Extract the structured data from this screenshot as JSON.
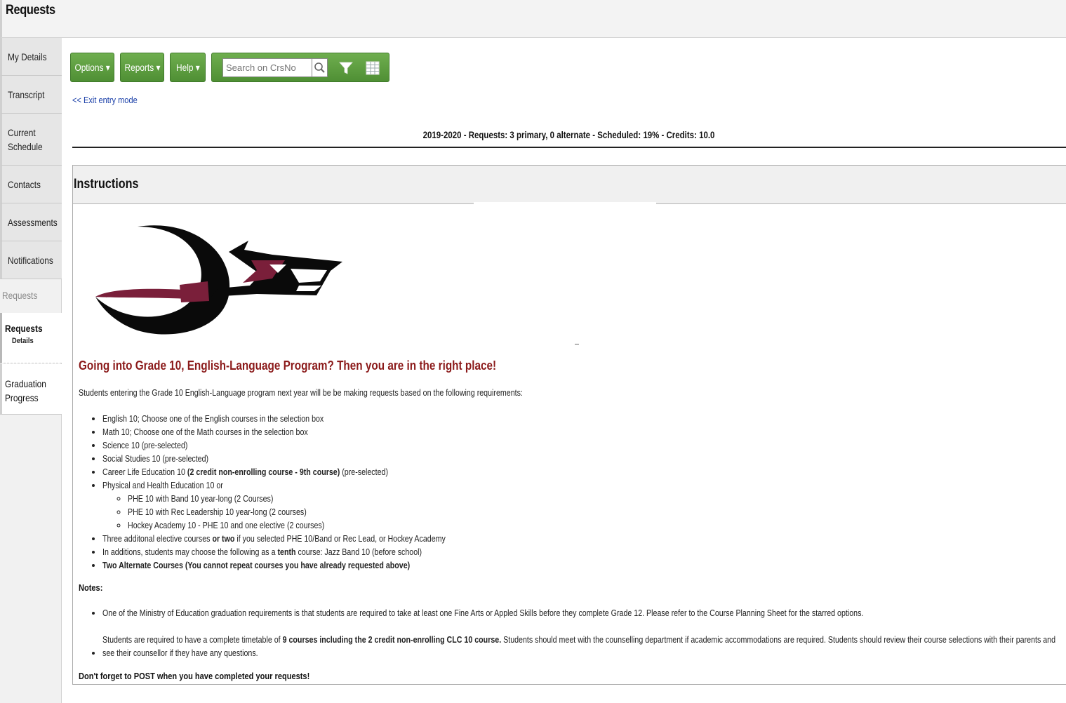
{
  "page": {
    "title": "Requests"
  },
  "sidebar": {
    "items": [
      {
        "label": "My Details"
      },
      {
        "label": "Transcript"
      },
      {
        "label_line1": "Current",
        "label_line2": "Schedule"
      },
      {
        "label": "Contacts"
      },
      {
        "label": "Assessments"
      },
      {
        "label": "Notifications"
      }
    ],
    "section_label": "Requests",
    "active": {
      "label": "Requests",
      "sub": "Details"
    },
    "grad": {
      "line1": "Graduation",
      "line2": "Progress"
    }
  },
  "toolbar": {
    "options_label": "Options ▾",
    "reports_label": "Reports ▾",
    "help_label": "Help ▾",
    "search_placeholder": "Search on CrsNo"
  },
  "exit_link": "<< Exit entry mode",
  "summary": "2019-2020 - Requests: 3 primary, 0 alternate - Scheduled: 19% - Credits: 10.0",
  "instructions": {
    "title": "Instructions",
    "headline": "Going into Grade 10, English-Language Program? Then you are in the right place!",
    "intro": "Students entering the Grade 10 English-Language program next year will be be making requests based on the following requirements:",
    "requirements": {
      "r1": "English 10; Choose one of the English courses in the selection box",
      "r2": "Math 10; Choose one of the Math courses in the selection box",
      "r3": "Science 10 (pre-selected)",
      "r4": "Social Studies 10 (pre-selected)",
      "r5_a": "Career Life Education 10 ",
      "r5_b": "(2 credit non-enrolling course - 9th course)",
      "r5_c": " (pre-selected)",
      "r6": "Physical and Health Education 10 or",
      "r6_sub1": "PHE 10 with Band 10 year-long (2 Courses)",
      "r6_sub2": "PHE 10 with Rec Leadership 10 year-long (2 courses)",
      "r6_sub3": "Hockey Academy 10 - PHE 10 and one elective (2 courses)",
      "r7_a": "Three additonal elective courses ",
      "r7_b": "or two",
      "r7_c": " if you selected PHE 10/Band or Rec Lead, or Hockey Academy",
      "r8_a": "In additions, students may choose the following as a ",
      "r8_b": "tenth",
      "r8_c": " course: Jazz Band 10 (before school)",
      "r9": "Two Alternate Courses (You cannot repeat courses you have already requested above)"
    },
    "notes_title": "Notes:",
    "note1": "One of the Ministry of Education graduation requirements is that students are required to take at least one Fine Arts or Appled Skills before they complete Grade 12. Please refer to the Course Planning Sheet for the starred options.",
    "note2_a": "Students are required to have a complete timetable of ",
    "note2_b": "9 courses including the 2 credit non-enrolling CLC 10 course.",
    "note2_c": " Students should meet with the counselling department if academic accommodations are required. Students should review their course selections with their parents and see their counsellor if they have any questions.",
    "post_reminder": "Don't forget to POST when you have completed your requests!"
  },
  "colors": {
    "toolbar_green": "#5a9c3c",
    "headline_red": "#8b1a1a",
    "link_blue": "#1a3fa8",
    "logo_maroon": "#7a1f3a"
  }
}
